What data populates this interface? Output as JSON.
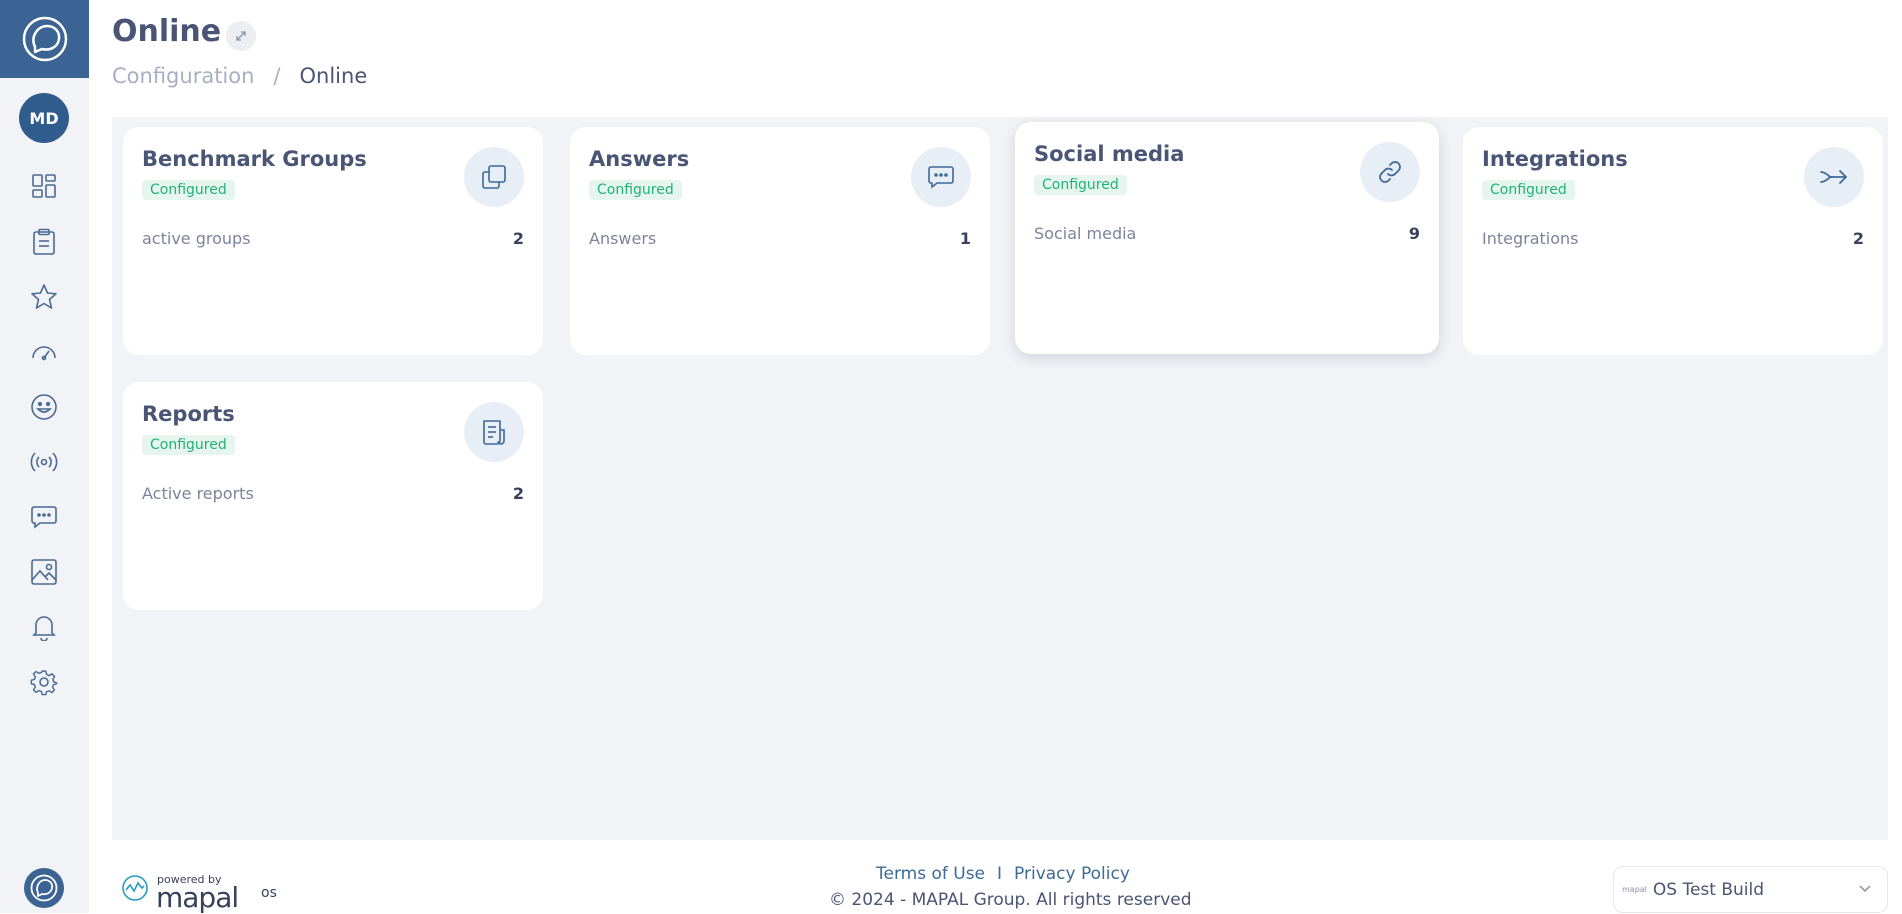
{
  "app": {
    "page_title": "Online",
    "breadcrumb": {
      "parent": "Configuration",
      "separator": "/",
      "current": "Online"
    }
  },
  "sidebar": {
    "avatar_initials": "MD",
    "items": [
      {
        "icon": "dashboard-icon"
      },
      {
        "icon": "clipboard-icon"
      },
      {
        "icon": "star-icon"
      },
      {
        "icon": "speedometer-icon"
      },
      {
        "icon": "smiley-icon"
      },
      {
        "icon": "broadcast-icon"
      },
      {
        "icon": "chat-icon"
      },
      {
        "icon": "image-icon"
      },
      {
        "icon": "bell-icon"
      },
      {
        "icon": "gear-icon"
      }
    ]
  },
  "cards": [
    {
      "title": "Benchmark Groups",
      "status": "Configured",
      "metric_label": "active groups",
      "metric_value": "2",
      "icon": "copy-icon"
    },
    {
      "title": "Answers",
      "status": "Configured",
      "metric_label": "Answers",
      "metric_value": "1",
      "icon": "chat-icon"
    },
    {
      "title": "Social media",
      "status": "Configured",
      "metric_label": "Social media",
      "metric_value": "9",
      "icon": "link-icon"
    },
    {
      "title": "Integrations",
      "status": "Configured",
      "metric_label": "Integrations",
      "metric_value": "2",
      "icon": "arrow-in-icon"
    },
    {
      "title": "Reports",
      "status": "Configured",
      "metric_label": "Active reports",
      "metric_value": "2",
      "icon": "report-icon"
    }
  ],
  "footer": {
    "terms_label": "Terms of Use",
    "separator": "I",
    "privacy_label": "Privacy Policy",
    "copyright": "© 2024 - MAPAL Group. All rights reserved",
    "powered_by": "powered by",
    "brand": "mapal",
    "brand_suffix": "os",
    "build_label": "OS Test Build",
    "build_logo_text": "mapal"
  },
  "colors": {
    "primary": "#3b6494",
    "badge_text": "#1fb27a",
    "badge_bg": "#e6f6ef",
    "background": "#f2f3f6"
  }
}
